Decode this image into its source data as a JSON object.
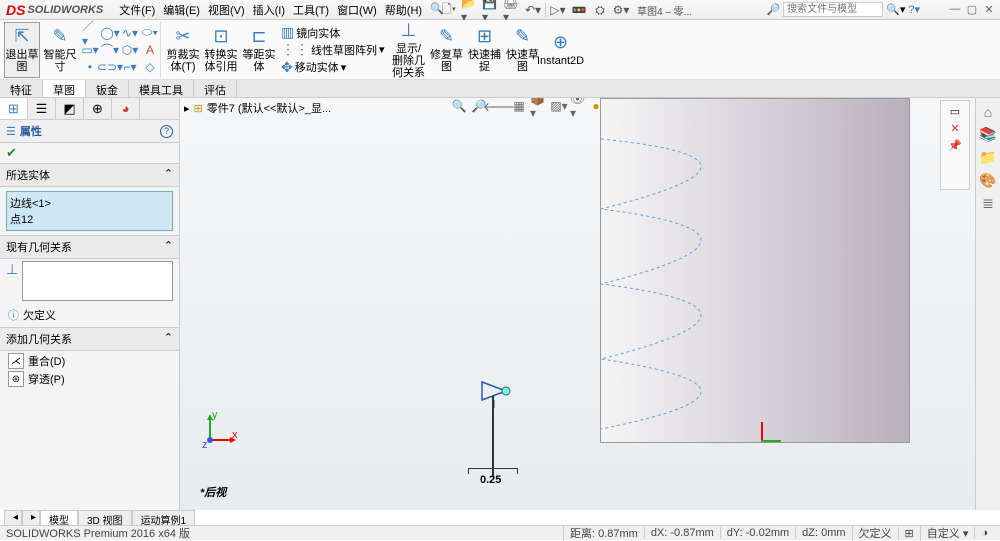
{
  "app": {
    "name": "SOLIDWORKS"
  },
  "menu": {
    "file": "文件(F)",
    "edit": "编辑(E)",
    "view": "视图(V)",
    "insert": "插入(I)",
    "tools": "工具(T)",
    "window": "窗口(W)",
    "help": "帮助(H)"
  },
  "qat_doc": "草图4 – 零...",
  "search": {
    "placeholder": "搜索文件与模型"
  },
  "ribbon": {
    "exit": "退出草图",
    "smartdim": "智能尺寸",
    "trim": "剪裁实体(T)",
    "convert": "转换实体引用",
    "offset": "等距实体",
    "mirror": "镜向实体",
    "pattern": "线性草图阵列",
    "move": "移动实体",
    "showhide": "显示/删除几何关系",
    "repair": "修复草图",
    "quicksnap": "快速捕捉",
    "rapid": "快速草图",
    "instant": "Instant2D"
  },
  "cmdtabs": {
    "feature": "特征",
    "sketch": "草图",
    "sheetmetal": "钣金",
    "moldtools": "模具工具",
    "evaluate": "评估"
  },
  "doc": {
    "name": "零件7 (默认<<默认>_显..."
  },
  "pm": {
    "title": "属性",
    "sec_selected": "所选实体",
    "items": [
      "边线<1>",
      "点12"
    ],
    "sec_existing": "现有几何关系",
    "underdef": "欠定义",
    "sec_add": "添加几何关系",
    "coincident": "重合(D)",
    "pierce": "穿透(P)"
  },
  "dim_value": "0.25",
  "backview": "*后视",
  "bottomtabs": {
    "model": "模型",
    "view3d": "3D 视图",
    "study": "运动算例1"
  },
  "status": {
    "edition": "SOLIDWORKS Premium 2016 x64 版",
    "dist": "距离: 0.87mm",
    "dx": "dX: -0.87mm",
    "dy": "dY: -0.02mm",
    "dz": "dZ: 0mm",
    "state": "欠定义",
    "custom": "自定义"
  }
}
